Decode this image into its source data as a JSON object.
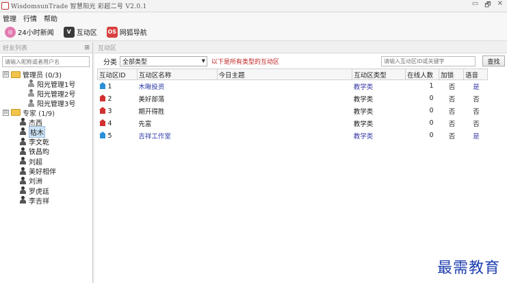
{
  "window": {
    "title": "WisdomsunTrade 智慧阳光 彩超二号 V2.0.1",
    "controls": [
      "▭",
      "🗗",
      "✕"
    ]
  },
  "menu": [
    "管理",
    "行情",
    "帮助"
  ],
  "toolbar": [
    {
      "label": "24小时新闻",
      "icon": "news-icon",
      "glyph": "◎"
    },
    {
      "label": "互动区",
      "icon": "interactive-icon",
      "glyph": "V"
    },
    {
      "label": "网狐导航",
      "icon": "nav-icon",
      "glyph": "OS"
    }
  ],
  "friends": {
    "title": "好友列表",
    "pin": "⊞",
    "search_placeholder": "请输入昵称或者用户名",
    "groups": [
      {
        "label": "管理员 (0/3)",
        "expander": "⊟",
        "items": [
          "阳光管理1号",
          "阳光管理2号",
          "阳光管理3号"
        ]
      },
      {
        "label": "专家 (1/9)",
        "expander": "⊟",
        "items": [
          "杰西",
          "枯木",
          "李文乾",
          "铁昌昀",
          "刘超",
          "美好相伴",
          "刘洲",
          "罗虎廷",
          "李吉祥"
        ],
        "selected": 1
      }
    ]
  },
  "rooms": {
    "title": "互动区",
    "filter_label": "分类",
    "filter_value": "全部类型",
    "filter_hint": "以下是所有类型的互动区",
    "search_placeholder": "请输入互动区ID或关键字",
    "find_label": "查找",
    "columns": [
      "互动区ID",
      "互动区名称",
      "今日主题",
      "互动区类型",
      "在线人数",
      "加锁",
      "语音"
    ],
    "rows": [
      {
        "id": "1",
        "name": "木啾投资",
        "topic": "",
        "type": "教学类",
        "online": "1",
        "lock": "否",
        "voice": "是",
        "icon": "blue"
      },
      {
        "id": "2",
        "name": "美好部落",
        "topic": "",
        "type": "教学类",
        "online": "0",
        "lock": "否",
        "voice": "否",
        "icon": "red"
      },
      {
        "id": "3",
        "name": "期开得胜",
        "topic": "",
        "type": "教学类",
        "online": "0",
        "lock": "否",
        "voice": "否",
        "icon": "red"
      },
      {
        "id": "4",
        "name": "先富",
        "topic": "",
        "type": "教学类",
        "online": "0",
        "lock": "否",
        "voice": "否",
        "icon": "red"
      },
      {
        "id": "5",
        "name": "吉祥工作室",
        "topic": "",
        "type": "教学类",
        "online": "0",
        "lock": "否",
        "voice": "是",
        "icon": "blue"
      }
    ]
  },
  "watermark": "最需教育",
  "colors": {
    "link_blue": "#2a3aa8",
    "hint_red": "#c02020",
    "icon_blue": "#2a8fd8",
    "icon_red": "#d23030"
  }
}
